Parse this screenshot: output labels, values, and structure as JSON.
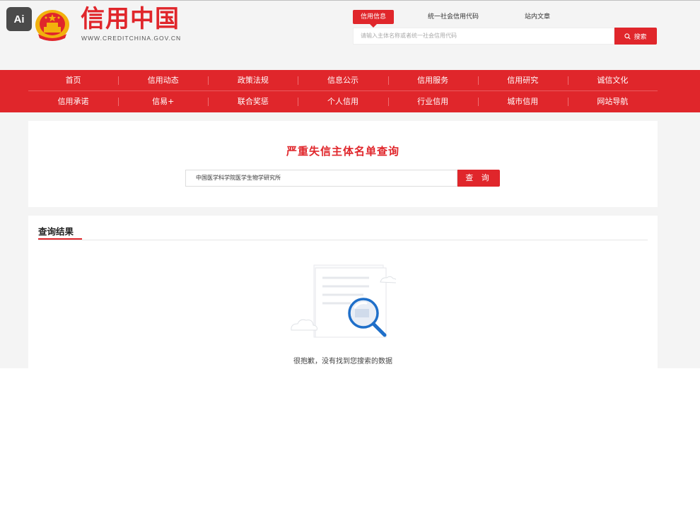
{
  "badge": {
    "label": "Ai"
  },
  "header": {
    "site_name": "信用中国",
    "site_url": "WWW.CREDITCHINA.GOV.CN",
    "search_tabs": [
      {
        "label": "信用信息",
        "active": true
      },
      {
        "label": "统一社会信用代码",
        "active": false
      },
      {
        "label": "站内文章",
        "active": false
      }
    ],
    "search_placeholder": "请输入主体名称或者统一社会信用代码",
    "search_button": "搜索"
  },
  "nav": {
    "row1": [
      "首页",
      "信用动态",
      "政策法规",
      "信息公示",
      "信用服务",
      "信用研究",
      "诚信文化"
    ],
    "row2": [
      "信用承诺",
      "信易+",
      "联合奖惩",
      "个人信用",
      "行业信用",
      "城市信用",
      "网站导航"
    ]
  },
  "query": {
    "title": "严重失信主体名单查询",
    "input_value": "中国医学科学院医学生物学研究所",
    "button": "查 询"
  },
  "result": {
    "title": "查询结果",
    "empty_message": "很抱歉，没有找到您搜索的数据"
  },
  "colors": {
    "brand": "#e0262b",
    "background": "#f4f4f4"
  }
}
